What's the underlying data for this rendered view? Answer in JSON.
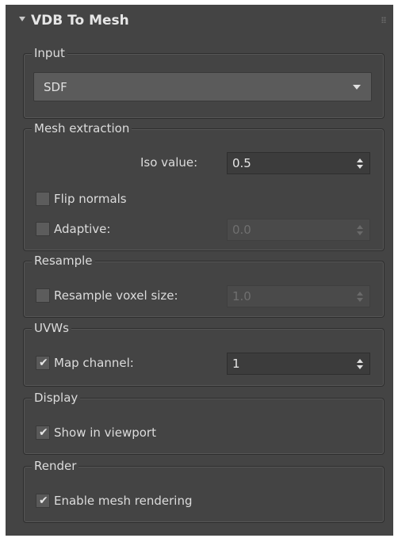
{
  "rollout": {
    "title": "VDB To Mesh"
  },
  "input": {
    "label": "Input",
    "dropdown_value": "SDF"
  },
  "mesh_extraction": {
    "label": "Mesh extraction",
    "iso_label": "Iso value:",
    "iso_value": "0.5",
    "flip_normals_label": "Flip normals",
    "flip_normals_checked": false,
    "adaptive_label": "Adaptive:",
    "adaptive_checked": false,
    "adaptive_value": "0.0"
  },
  "resample": {
    "label": "Resample",
    "voxel_label": "Resample voxel size:",
    "voxel_checked": false,
    "voxel_value": "1.0"
  },
  "uvws": {
    "label": "UVWs",
    "map_channel_label": "Map channel:",
    "map_channel_checked": true,
    "map_channel_value": "1"
  },
  "display": {
    "label": "Display",
    "show_label": "Show in viewport",
    "show_checked": true
  },
  "render": {
    "label": "Render",
    "enable_label": "Enable mesh rendering",
    "enable_checked": true
  },
  "icons": {
    "check": "✔",
    "collapse": "triangle-down-icon",
    "dropdown": "dropdown-arrow-icon",
    "spinner": "spinner-arrows-icon",
    "grip": "grip-dots-icon"
  },
  "colors": {
    "panel_bg": "#444444",
    "field_bg": "#3c3c3c",
    "text": "#dcdcdc"
  }
}
